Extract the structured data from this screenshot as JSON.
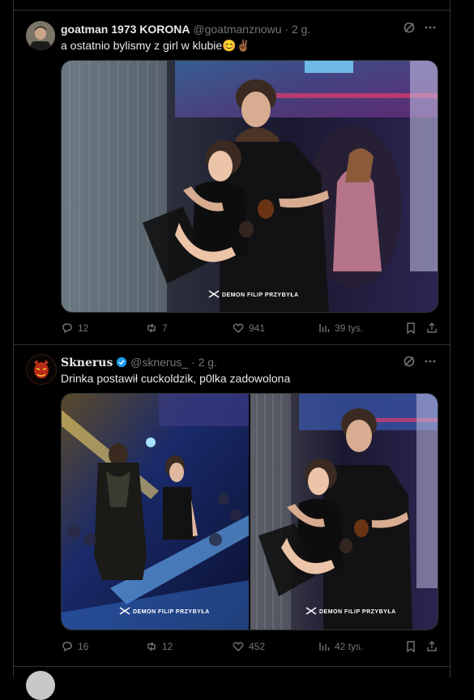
{
  "tweets": [
    {
      "name": "goatman 1973 KORONA",
      "handle": "@goatmanznowu",
      "dot": "·",
      "time": "2 g.",
      "text": "a ostatnio bylismy z girl w klubie😊✌🏾",
      "watermark": "DEMON  FILIP PRZYBYŁA",
      "replies": "12",
      "reposts": "7",
      "likes": "941",
      "views": "39 tys."
    },
    {
      "name": "Sknerus",
      "handle": "@sknerus_",
      "dot": "·",
      "time": "2 g.",
      "text": "Drinka postawił cuckoldzik, p0lka zadowolona",
      "watermark_left": "DEMON  FILIP PRZYBYŁA",
      "watermark_right": "DEMON  FILIP PRZYBYŁA",
      "replies": "16",
      "reposts": "12",
      "likes": "452",
      "views": "42 tys."
    }
  ],
  "icons": [
    "grok-icon",
    "more-icon",
    "reply-icon",
    "repost-icon",
    "like-icon",
    "views-icon",
    "bookmark-icon",
    "share-icon",
    "verified-icon"
  ]
}
